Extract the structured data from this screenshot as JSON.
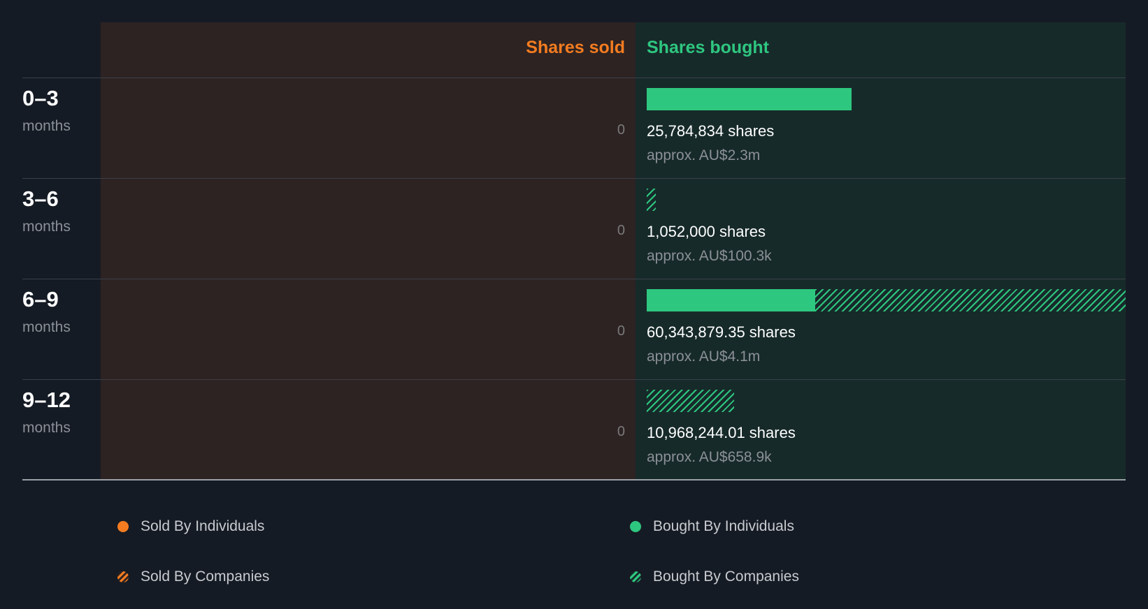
{
  "chart_data": {
    "type": "bar",
    "orientation": "horizontal",
    "header": {
      "sold": "Shares sold",
      "bought": "Shares bought"
    },
    "unit": "months",
    "max_shares": 60343879.35,
    "rows": [
      {
        "period": "0–3",
        "sold_label": "0",
        "shares_label": "25,784,834 shares",
        "approx_label": "approx. AU$2.3m",
        "bought_individuals": 25784834,
        "bought_companies": 0
      },
      {
        "period": "3–6",
        "sold_label": "0",
        "shares_label": "1,052,000 shares",
        "approx_label": "approx. AU$100.3k",
        "bought_individuals": 0,
        "bought_companies": 1052000
      },
      {
        "period": "6–9",
        "sold_label": "0",
        "shares_label": "60,343,879.35 shares",
        "approx_label": "approx. AU$4.1m",
        "bought_individuals": 21200000,
        "bought_companies": 39143879.35
      },
      {
        "period": "9–12",
        "sold_label": "0",
        "shares_label": "10,968,244.01 shares",
        "approx_label": "approx. AU$658.9k",
        "bought_individuals": 0,
        "bought_companies": 10968244.01
      }
    ],
    "legend": {
      "sold_individuals": "Sold By Individuals",
      "sold_companies": "Sold By Companies",
      "bought_individuals": "Bought By Individuals",
      "bought_companies": "Bought By Companies"
    },
    "colors": {
      "sold": "#f47c20",
      "bought": "#2ec780",
      "sold_bg": "#2d2322",
      "bought_bg": "#172a2a"
    }
  }
}
